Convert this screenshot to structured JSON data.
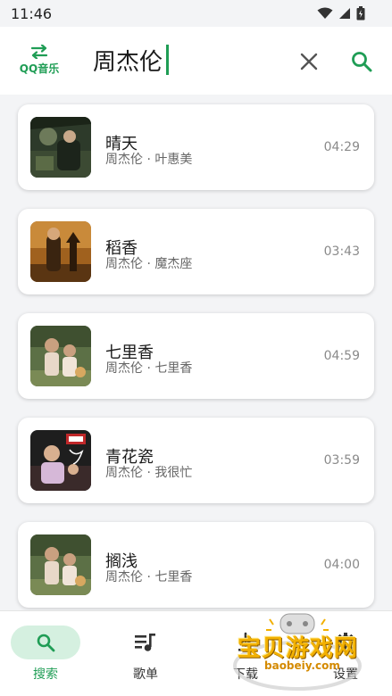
{
  "status": {
    "time": "11:46"
  },
  "header": {
    "source_label": "QQ音乐",
    "query": "周杰伦"
  },
  "songs": [
    {
      "title": "晴天",
      "subtitle": "周杰伦 · 叶惠美",
      "duration": "04:29"
    },
    {
      "title": "稻香",
      "subtitle": "周杰伦 · 魔杰座",
      "duration": "03:43"
    },
    {
      "title": "七里香",
      "subtitle": "周杰伦 · 七里香",
      "duration": "04:59"
    },
    {
      "title": "青花瓷",
      "subtitle": "周杰伦 · 我很忙",
      "duration": "03:59"
    },
    {
      "title": "搁浅",
      "subtitle": "周杰伦 · 七里香",
      "duration": "04:00"
    }
  ],
  "nav": {
    "search": "搜索",
    "playlist": "歌单",
    "download": "下载",
    "settings": "设置"
  },
  "watermark": {
    "text": "宝贝游戏网",
    "url": "baobeiy.com"
  },
  "colors": {
    "accent": "#1f9d55",
    "accent_bg": "#d5f0e0"
  }
}
